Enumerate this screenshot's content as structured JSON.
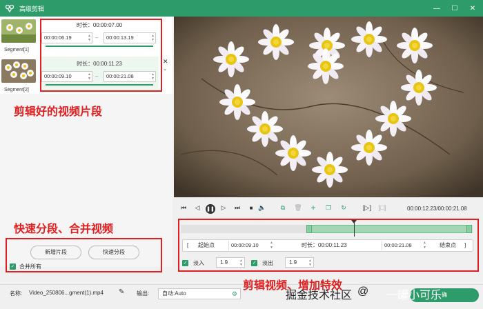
{
  "window": {
    "title": "高级剪辑",
    "min": "—",
    "max": "☐",
    "close": "✕"
  },
  "segments": [
    {
      "label": "Segment[1]",
      "duration": "时长：00:00:07.00",
      "start": "00:00:06.19",
      "end": "00:00:13.19"
    },
    {
      "label": "Segment[2]",
      "duration": "时长：00:00:11.23",
      "start": "00:00:09.10",
      "end": "00:00:21.08"
    }
  ],
  "annotations": {
    "clips": "剪辑好的视频片段",
    "split_merge": "快速分段、合并视频",
    "edit_effects": "剪辑视频、增加特效"
  },
  "left_panel": {
    "add_segment": "新增片段",
    "quick_split": "快速分段",
    "merge_all": "合并所有",
    "close_segment": "✕"
  },
  "controls": {
    "time_display": "00:00:12.23/00:00:21.08"
  },
  "trim": {
    "start_point_label": "起始点",
    "start_bracket": "[",
    "start_time": "00:00:09.10",
    "duration": "时长：00:00:11.23",
    "end_time": "00:00:21.08",
    "end_point_label": "结束点",
    "end_bracket": "]",
    "fade_in_label": "淡入",
    "fade_in_value": "1.9",
    "fade_out_label": "淡出",
    "fade_out_value": "1.9"
  },
  "bottom": {
    "name_label": "名称:",
    "file_name": "Video_250806...gment(1).mp4",
    "output_label": "输出:",
    "output_value": "自动:Auto"
  },
  "watermark": {
    "site": "掘金技术社区",
    "at": "@",
    "author": "一罐小可乐",
    "partial_button": "确"
  }
}
